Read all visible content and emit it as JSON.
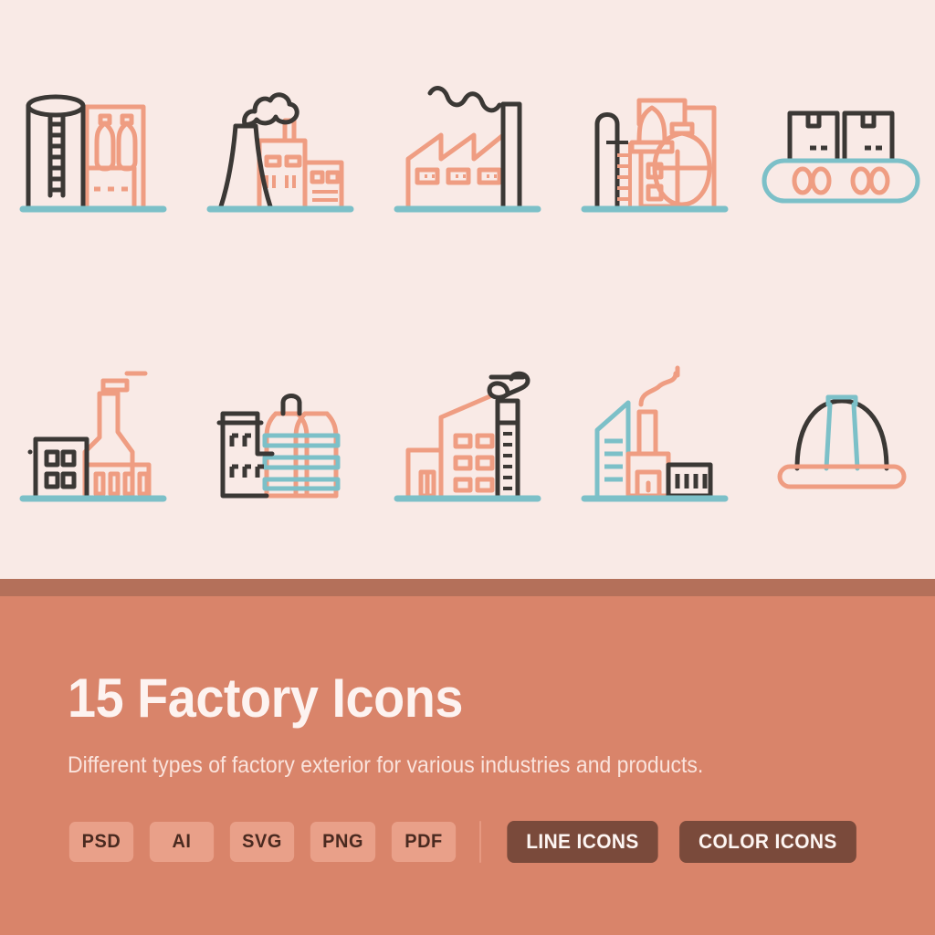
{
  "palette": {
    "background": "#f9eae6",
    "band": "#b4705a",
    "footer": "#d9846a",
    "salmon": "#ef9d82",
    "charcoal": "#3b3835",
    "teal": "#7cc0c8",
    "badge_bg": "#e9a089",
    "badge_text": "#4a2a20",
    "button_bg": "#7a4a3b",
    "button_text": "#fdf5f2",
    "title_text": "#fdf3f0",
    "subtitle_text": "#fae3dc"
  },
  "footer": {
    "title": "15 Factory Icons",
    "subtitle": "Different types of factory exterior for various industries and products.",
    "formats": [
      {
        "label": "PSD"
      },
      {
        "label": "AI"
      },
      {
        "label": "SVG"
      },
      {
        "label": "PNG"
      },
      {
        "label": "PDF"
      }
    ],
    "buttons": [
      {
        "label": "LINE ICONS"
      },
      {
        "label": "COLOR ICONS"
      }
    ]
  },
  "showcase": {
    "icons": [
      {
        "name": "silo-tank-with-ladder-icon",
        "label": "Storage silo with ladder and bottling tanks"
      },
      {
        "name": "cooling-tower-smoke-icon",
        "label": "Cooling tower with smoke and factory blocks"
      },
      {
        "name": "sawtooth-roof-factory-icon",
        "label": "Sawtooth roof factory with chimney and smoke"
      },
      {
        "name": "refinery-vessels-icon",
        "label": "Refinery with distillation vessels and tower"
      },
      {
        "name": "conveyor-belt-boxes-icon",
        "label": "Conveyor belt carrying cardboard boxes"
      },
      {
        "name": "office-and-smokestack-icon",
        "label": "Office block beside factory smokestack"
      },
      {
        "name": "banded-silos-factory-icon",
        "label": "Factory with banded twin silos"
      },
      {
        "name": "chimney-smoke-loop-icon",
        "label": "Factory with ladder chimney and looping smoke"
      },
      {
        "name": "industrial-complex-icon",
        "label": "Industrial complex with tower and warehouse"
      },
      {
        "name": "hard-hat-icon",
        "label": "Safety hard hat"
      }
    ]
  }
}
